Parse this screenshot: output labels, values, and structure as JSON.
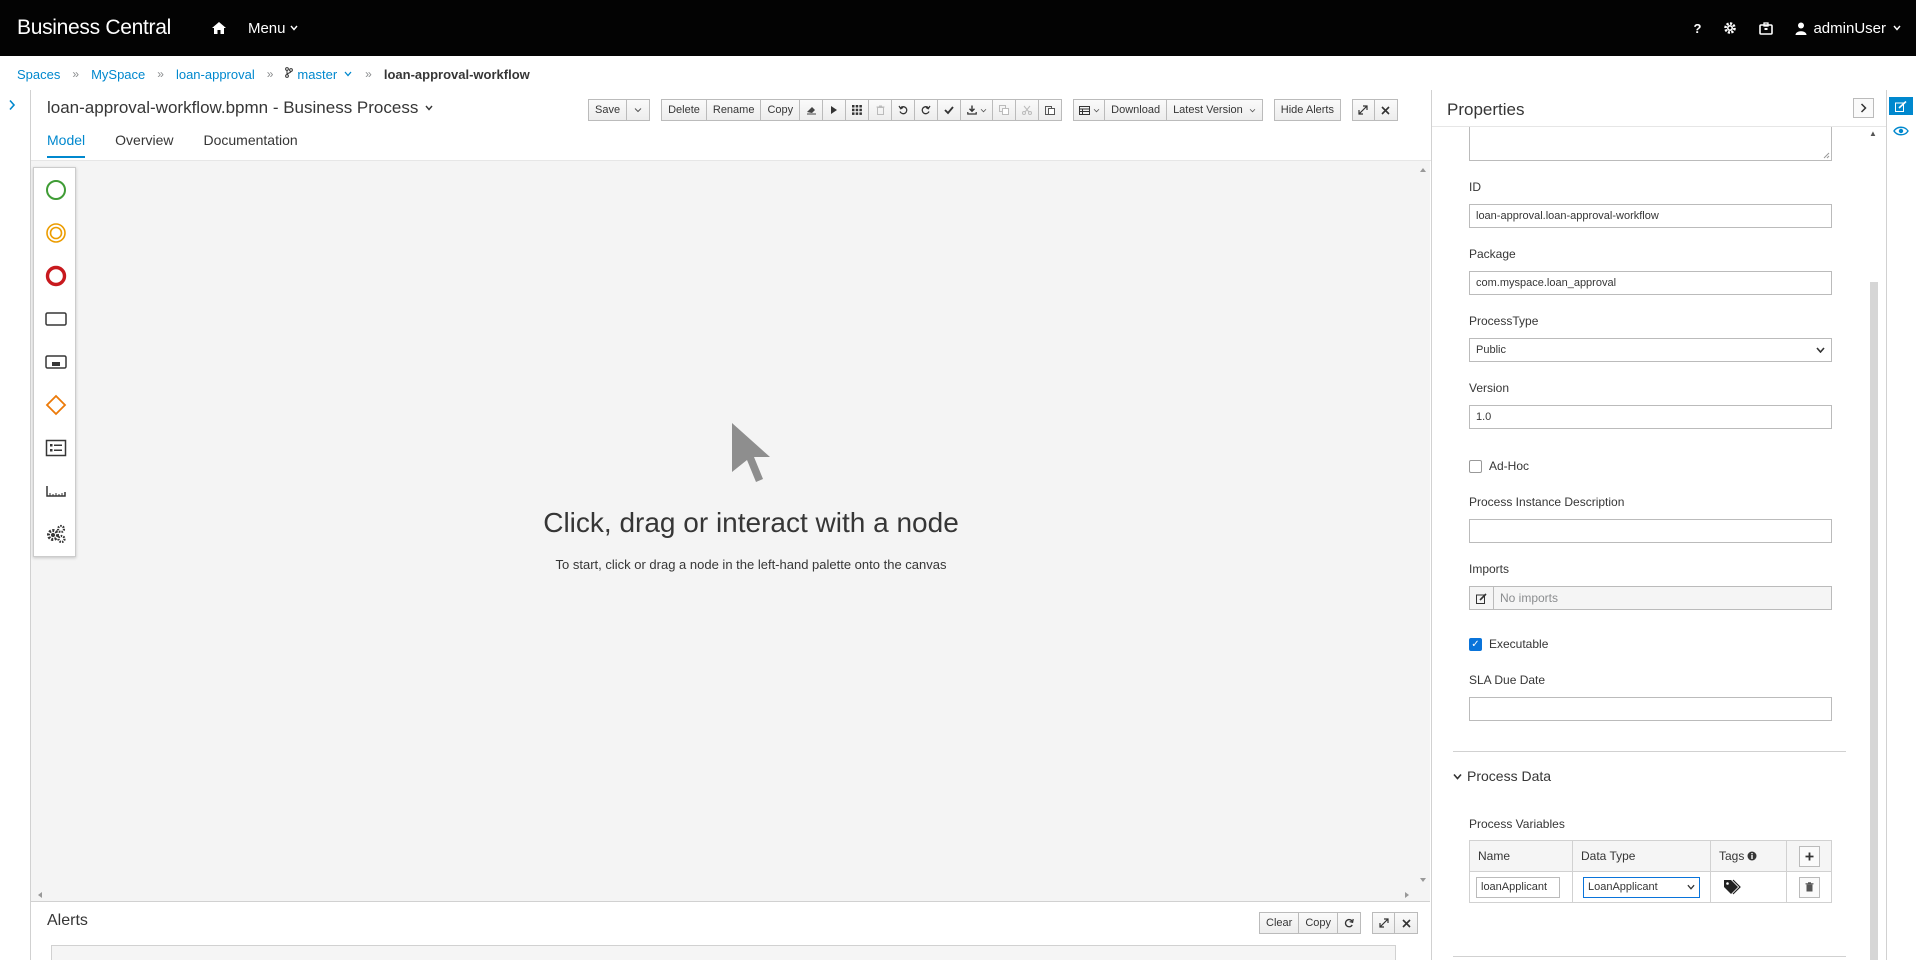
{
  "topbar": {
    "brand": "Business Central",
    "menu_label": "Menu",
    "help_label": "?",
    "user_label": "adminUser"
  },
  "breadcrumb": {
    "items": [
      "Spaces",
      "MySpace",
      "loan-approval",
      "master"
    ],
    "current": "loan-approval-workflow"
  },
  "editor": {
    "title": "loan-approval-workflow.bpmn - Business Process",
    "toolbar": {
      "save": "Save",
      "delete": "Delete",
      "rename": "Rename",
      "copy": "Copy",
      "download": "Download",
      "latest_version": "Latest Version",
      "hide_alerts": "Hide Alerts"
    },
    "tabs": [
      "Model",
      "Overview",
      "Documentation"
    ],
    "canvas_heading": "Click, drag or interact with a node",
    "canvas_hint": "To start, click or drag a node in the left-hand palette onto the canvas"
  },
  "alerts": {
    "title": "Alerts",
    "clear": "Clear",
    "copy": "Copy"
  },
  "properties": {
    "title": "Properties",
    "id_label": "ID",
    "id_value": "loan-approval.loan-approval-workflow",
    "package_label": "Package",
    "package_value": "com.myspace.loan_approval",
    "process_type_label": "ProcessType",
    "process_type_value": "Public",
    "version_label": "Version",
    "version_value": "1.0",
    "adhoc_label": "Ad-Hoc",
    "adhoc_checked": false,
    "instance_desc_label": "Process Instance Description",
    "instance_desc_value": "",
    "imports_label": "Imports",
    "imports_value": "No imports",
    "executable_label": "Executable",
    "executable_checked": true,
    "sla_label": "SLA Due Date",
    "sla_value": "",
    "process_data_title": "Process Data",
    "process_variables_label": "Process Variables",
    "variables_headers": [
      "Name",
      "Data Type",
      "Tags"
    ],
    "variables": [
      {
        "name": "loanApplicant",
        "type": "LoanApplicant"
      }
    ]
  },
  "colors": {
    "topbar_bg": "#030303",
    "accent": "#0088ce",
    "canvas_bg": "#f4f4f4"
  }
}
